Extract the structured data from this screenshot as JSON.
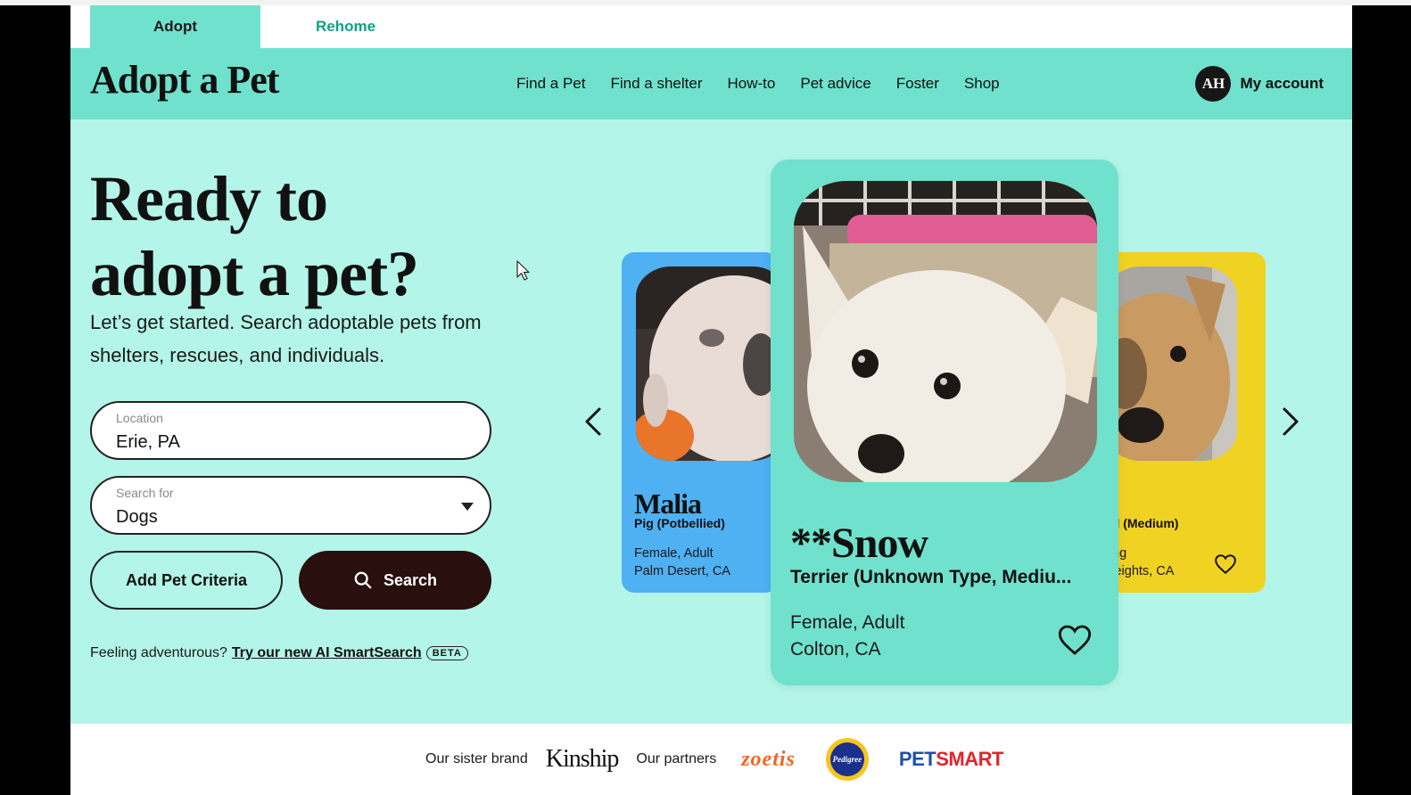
{
  "tabs": [
    {
      "label": "Adopt",
      "active": true
    },
    {
      "label": "Rehome",
      "active": false
    }
  ],
  "header": {
    "logo": "Adopt a Pet",
    "nav": [
      "Find a Pet",
      "Find a shelter",
      "How-to",
      "Pet advice",
      "Foster",
      "Shop"
    ],
    "account": {
      "initials": "AH",
      "label": "My account"
    }
  },
  "hero": {
    "title_line1": "Ready to",
    "title_line2": "adopt a pet?",
    "subtitle": "Let’s get started. Search adoptable pets from shelters, rescues, and individuals."
  },
  "search": {
    "location_label": "Location",
    "location_value": "Erie, PA",
    "type_label": "Search for",
    "type_value": "Dogs",
    "criteria_button": "Add Pet Criteria",
    "search_button": "Search"
  },
  "smartsearch": {
    "prefix": "Feeling adventurous?",
    "link": "Try our new AI SmartSearch",
    "badge": "BETA"
  },
  "carousel": {
    "left": {
      "name": "Malia",
      "breed": "Pig (Potbellied)",
      "meta1": "Female, Adult",
      "meta2": "Palm Desert, CA"
    },
    "main": {
      "name": "**Snow",
      "breed": "Terrier (Unknown Type, Mediu...",
      "meta1": "Female, Adult",
      "meta2": "Colton, CA"
    },
    "right": {
      "breed": "ed (Medium)",
      "meta1": "ung",
      "meta2": "Heights, CA"
    }
  },
  "footer": {
    "sister_label": "Our sister brand",
    "sister_brand": "Kinship",
    "partners_label": "Our partners",
    "partner1": "zoetis",
    "partner2": "Pedigree",
    "partner3a": "PET",
    "partner3b": "SMART"
  },
  "colors": {
    "page_bg": "#b3f5e8",
    "header_bg": "#70e1cc",
    "tab_link": "#0f9f86",
    "search_button": "#2a0f0f",
    "card_left": "#4fb0f2",
    "card_right": "#f0d223"
  }
}
